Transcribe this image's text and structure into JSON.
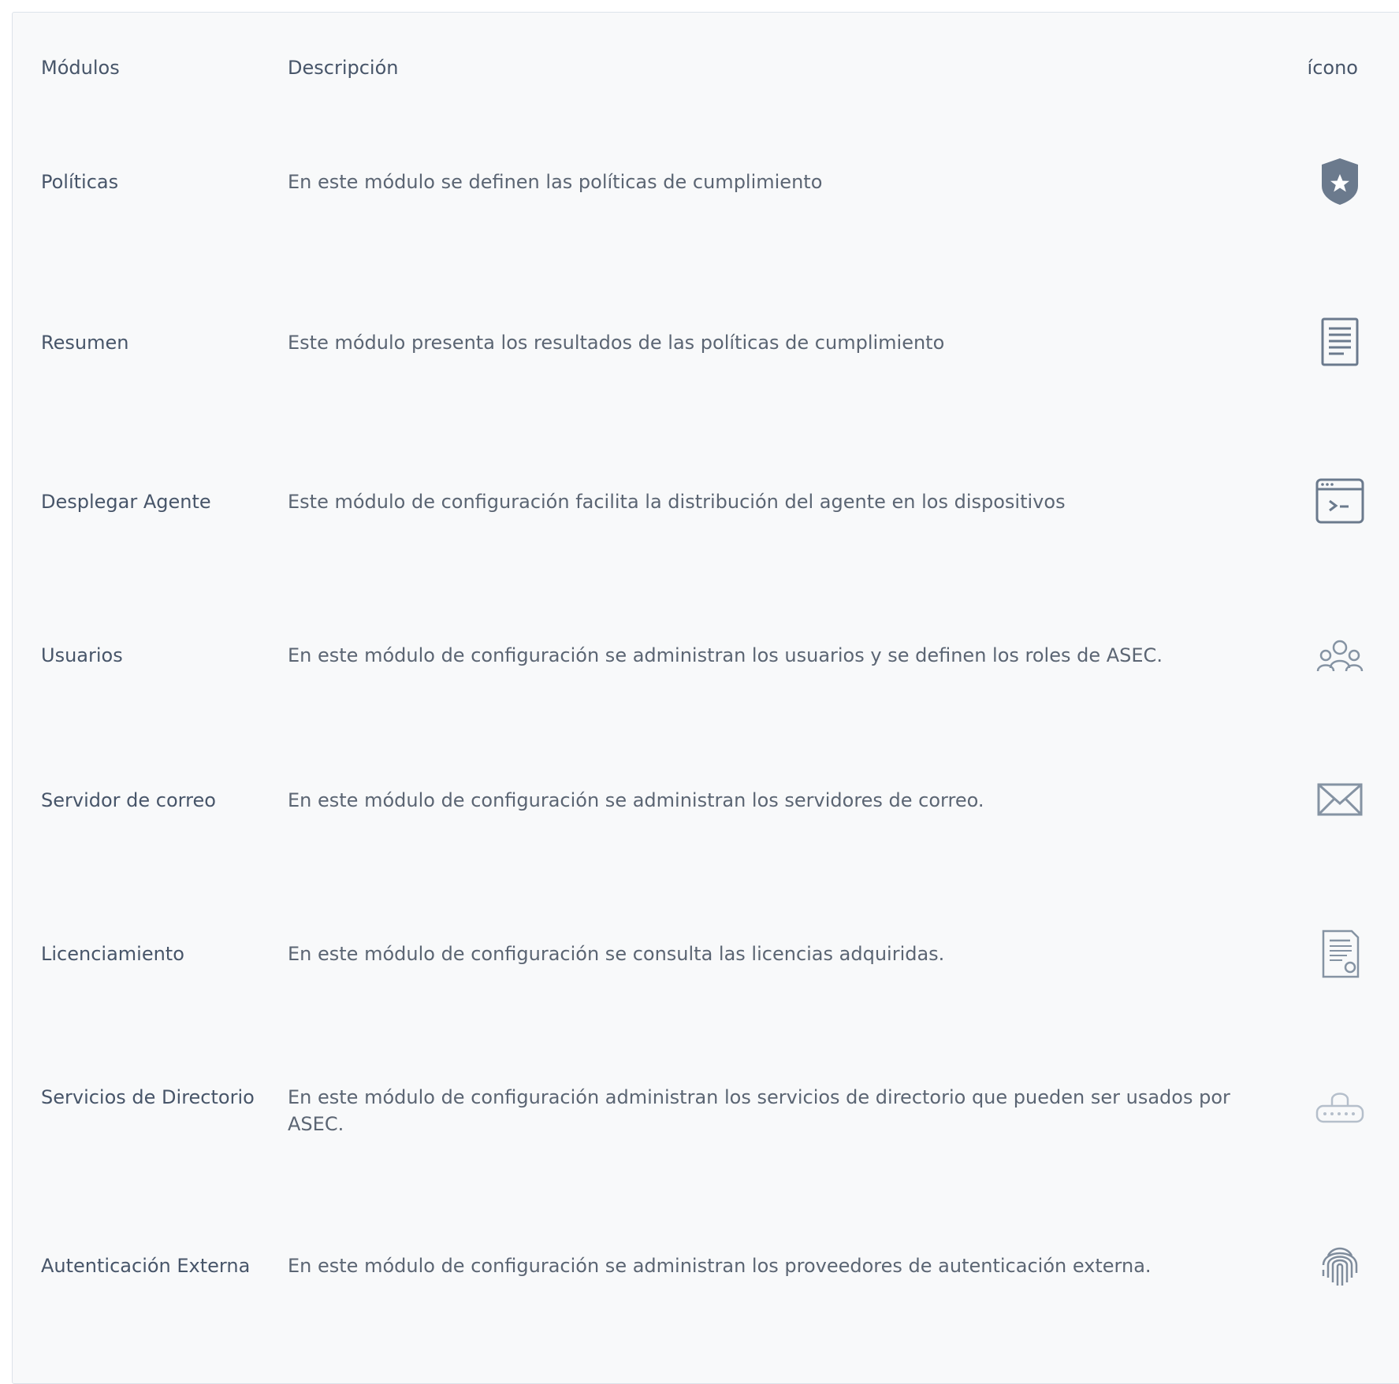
{
  "header": {
    "modules": "Módulos",
    "description": "Descripción",
    "icon": "ícono"
  },
  "rows": [
    {
      "module": "Políticas",
      "description": "En este módulo se definen las políticas de cumplimiento",
      "icon": "shield-star-icon"
    },
    {
      "module": "Resumen",
      "description": "Este módulo presenta los resultados de las políticas de cumplimiento",
      "icon": "document-list-icon"
    },
    {
      "module": "Desplegar Agente",
      "description": "Este módulo de configuración facilita la distribución del agente en los dispositivos",
      "icon": "terminal-window-icon"
    },
    {
      "module": "Usuarios",
      "description": "En este módulo de configuración se administran los usuarios y se definen los roles de ASEC.",
      "icon": "users-group-icon"
    },
    {
      "module": "Servidor de correo",
      "description": "En este módulo de configuración se administran los servidores de correo.",
      "icon": "envelope-icon"
    },
    {
      "module": "Licenciamiento",
      "description": "En este módulo de configuración se consulta las licencias adquiridas.",
      "icon": "license-certificate-icon"
    },
    {
      "module": "Servicios de Directorio",
      "description": "En este módulo de configuración administran los servicios de directorio que pueden ser usados por ASEC.",
      "icon": "lock-password-icon"
    },
    {
      "module": "Autenticación Externa",
      "description": "En este módulo de configuración se administran los proveedores de autenticación externa.",
      "icon": "fingerprint-icon"
    }
  ]
}
